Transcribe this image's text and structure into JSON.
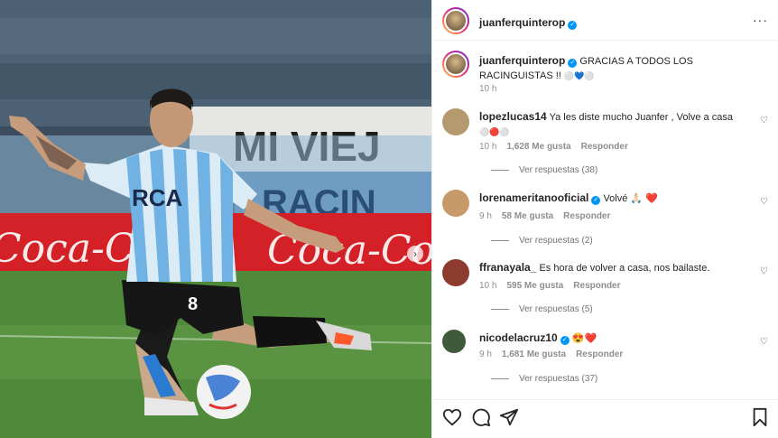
{
  "post": {
    "author": "juanferquinterop",
    "caption_author": "juanferquinterop",
    "caption_text": "GRACIAS A TODOS LOS RACINGUISTAS !! ",
    "caption_emoji": "⚪💙⚪",
    "caption_time": "10 h"
  },
  "photo": {
    "banner_text": "MI VIEJ",
    "banner_text2": "RACIN",
    "ad_text_left": "Coca-Cola",
    "ad_text_right": "Coca-Cola",
    "shirt_sponsor": "RCA",
    "shirt_number": "8"
  },
  "comments": [
    {
      "username": "lopezlucas14",
      "verified": false,
      "text": "Ya les diste mucho Juanfer , Volve a casa",
      "text2": "⚪🔴⚪",
      "time": "10 h",
      "likes": "1,628 Me gusta",
      "reply": "Responder",
      "replies": "Ver respuestas (38)",
      "avatar_color": "#b49a6e"
    },
    {
      "username": "lorenameritanooficial",
      "verified": true,
      "text": "Volvé 🙏🏻 ❤️",
      "time": "9 h",
      "likes": "58 Me gusta",
      "reply": "Responder",
      "replies": "Ver respuestas (2)",
      "avatar_color": "#c89a6a"
    },
    {
      "username": "ffranayala_",
      "verified": false,
      "text": "Es hora de volver a casa, nos bailaste.",
      "time": "10 h",
      "likes": "595 Me gusta",
      "reply": "Responder",
      "replies": "Ver respuestas (5)",
      "avatar_color": "#8c3b2e"
    },
    {
      "username": "nicodelacruz10",
      "verified": true,
      "text": "😍❤️",
      "time": "9 h",
      "likes": "1,681 Me gusta",
      "reply": "Responder",
      "replies": "Ver respuestas (37)",
      "avatar_color": "#3f5a3a"
    }
  ],
  "icons": {
    "like": "heart-icon",
    "comment": "comment-icon",
    "share": "share-icon",
    "save": "bookmark-icon",
    "more": "more-icon",
    "next": "chevron-right-icon"
  },
  "colors": {
    "verified": "#0095f6",
    "text": "#262626",
    "muted": "#8e8e8e"
  }
}
